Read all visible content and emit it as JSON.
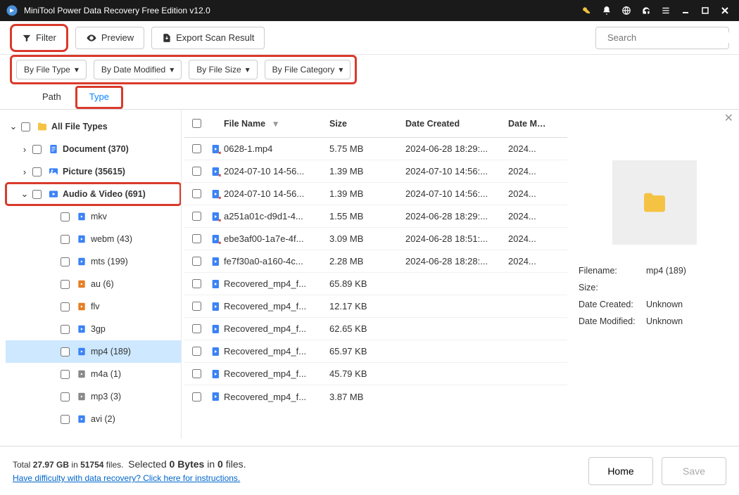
{
  "titlebar": {
    "title": "MiniTool Power Data Recovery Free Edition v12.0"
  },
  "toolbar": {
    "filter": "Filter",
    "preview": "Preview",
    "export": "Export Scan Result",
    "search_placeholder": "Search"
  },
  "filters": {
    "byType": "By File Type",
    "byDate": "By Date Modified",
    "bySize": "By File Size",
    "byCat": "By File Category"
  },
  "tabs": {
    "path": "Path",
    "type": "Type"
  },
  "tree": {
    "all": "All File Types",
    "doc": "Document (370)",
    "pic": "Picture (35615)",
    "av": "Audio & Video (691)",
    "items": [
      {
        "label": "mkv"
      },
      {
        "label": "webm (43)"
      },
      {
        "label": "mts (199)"
      },
      {
        "label": "au (6)"
      },
      {
        "label": "flv"
      },
      {
        "label": "3gp"
      },
      {
        "label": "mp4 (189)",
        "sel": true
      },
      {
        "label": "m4a (1)"
      },
      {
        "label": "mp3 (3)"
      },
      {
        "label": "avi (2)"
      }
    ]
  },
  "cols": {
    "name": "File Name",
    "size": "Size",
    "created": "Date Created",
    "modified": "Date Modif"
  },
  "rows": [
    {
      "name": "0628-1.mp4",
      "size": "5.75 MB",
      "created": "2024-06-28 18:29:...",
      "mod": "2024...",
      "broken": true
    },
    {
      "name": "2024-07-10 14-56...",
      "size": "1.39 MB",
      "created": "2024-07-10 14:56:...",
      "mod": "2024...",
      "broken": true
    },
    {
      "name": "2024-07-10 14-56...",
      "size": "1.39 MB",
      "created": "2024-07-10 14:56:...",
      "mod": "2024...",
      "broken": true
    },
    {
      "name": "a251a01c-d9d1-4...",
      "size": "1.55 MB",
      "created": "2024-06-28 18:29:...",
      "mod": "2024...",
      "broken": true
    },
    {
      "name": "ebe3af00-1a7e-4f...",
      "size": "3.09 MB",
      "created": "2024-06-28 18:51:...",
      "mod": "2024...",
      "broken": true
    },
    {
      "name": "fe7f30a0-a160-4c...",
      "size": "2.28 MB",
      "created": "2024-06-28 18:28:...",
      "mod": "2024..."
    },
    {
      "name": "Recovered_mp4_f...",
      "size": "65.89 KB",
      "created": "",
      "mod": ""
    },
    {
      "name": "Recovered_mp4_f...",
      "size": "12.17 KB",
      "created": "",
      "mod": ""
    },
    {
      "name": "Recovered_mp4_f...",
      "size": "62.65 KB",
      "created": "",
      "mod": ""
    },
    {
      "name": "Recovered_mp4_f...",
      "size": "65.97 KB",
      "created": "",
      "mod": ""
    },
    {
      "name": "Recovered_mp4_f...",
      "size": "45.79 KB",
      "created": "",
      "mod": ""
    },
    {
      "name": "Recovered_mp4_f...",
      "size": "3.87 MB",
      "created": "",
      "mod": ""
    }
  ],
  "details": {
    "filename_k": "Filename:",
    "filename_v": "mp4 (189)",
    "size_k": "Size:",
    "size_v": "",
    "created_k": "Date Created:",
    "created_v": "Unknown",
    "modified_k": "Date Modified:",
    "modified_v": "Unknown"
  },
  "footer": {
    "total_pre": "Total ",
    "total_size": "27.97 GB",
    "total_mid": " in ",
    "total_files": "51754",
    "total_post": " files.",
    "sel_pre": "Selected ",
    "sel_bytes": "0 Bytes",
    "sel_mid": " in ",
    "sel_n": "0",
    "sel_post": " files.",
    "help": "Have difficulty with data recovery? Click here for instructions.",
    "home": "Home",
    "save": "Save"
  }
}
